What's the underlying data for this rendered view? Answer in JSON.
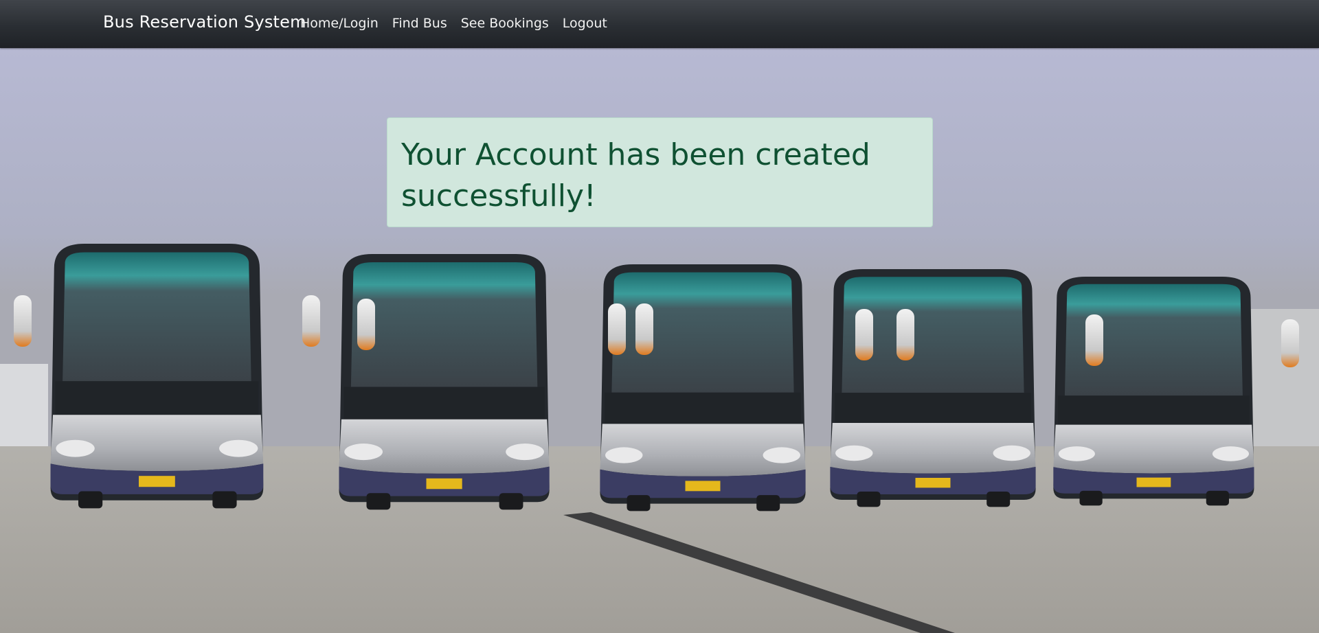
{
  "navbar": {
    "brand": "Bus Reservation System",
    "links": [
      "Home/Login",
      "Find Bus",
      "See Bookings",
      "Logout"
    ]
  },
  "alert": {
    "message": "Your Account has been created successfully!",
    "type": "success"
  },
  "colors": {
    "navbar_bg": "#2a2e33",
    "alert_bg": "#d1e7dd",
    "alert_text": "#0f5132"
  },
  "hero": {
    "image": "fleet-of-buses-photo",
    "buses": 5
  }
}
